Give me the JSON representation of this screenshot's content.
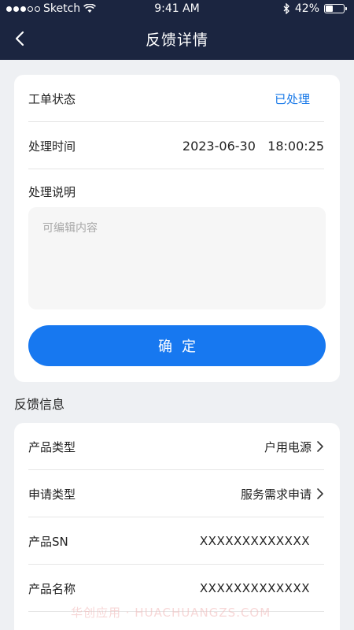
{
  "status_bar": {
    "carrier": "Sketch",
    "time": "9:41 AM",
    "battery": "42%",
    "battery_level": 0.42
  },
  "nav": {
    "title": "反馈详情"
  },
  "process_card": {
    "order_status_label": "工单状态",
    "order_status_value": "已处理",
    "process_time_label": "处理时间",
    "process_time_value": "2023-06-30   18:00:25",
    "process_note_label": "处理说明",
    "note_placeholder": "可编辑内容",
    "confirm_label": "确定"
  },
  "feedback_section": {
    "title": "反馈信息",
    "rows": [
      {
        "label": "产品类型",
        "value": "户用电源"
      },
      {
        "label": "申请类型",
        "value": "服务需求申请"
      },
      {
        "label": "产品SN",
        "value": "XXXXXXXXXXXXX"
      },
      {
        "label": "产品名称",
        "value": "XXXXXXXXXXXXX"
      }
    ]
  },
  "watermark": "华创应用 · HUACHUANGZS.COM",
  "colors": {
    "nav_bg": "#1b2540",
    "accent_blue": "#1778f0",
    "status_blue": "#1778e8",
    "page_bg": "#eef0f3"
  }
}
